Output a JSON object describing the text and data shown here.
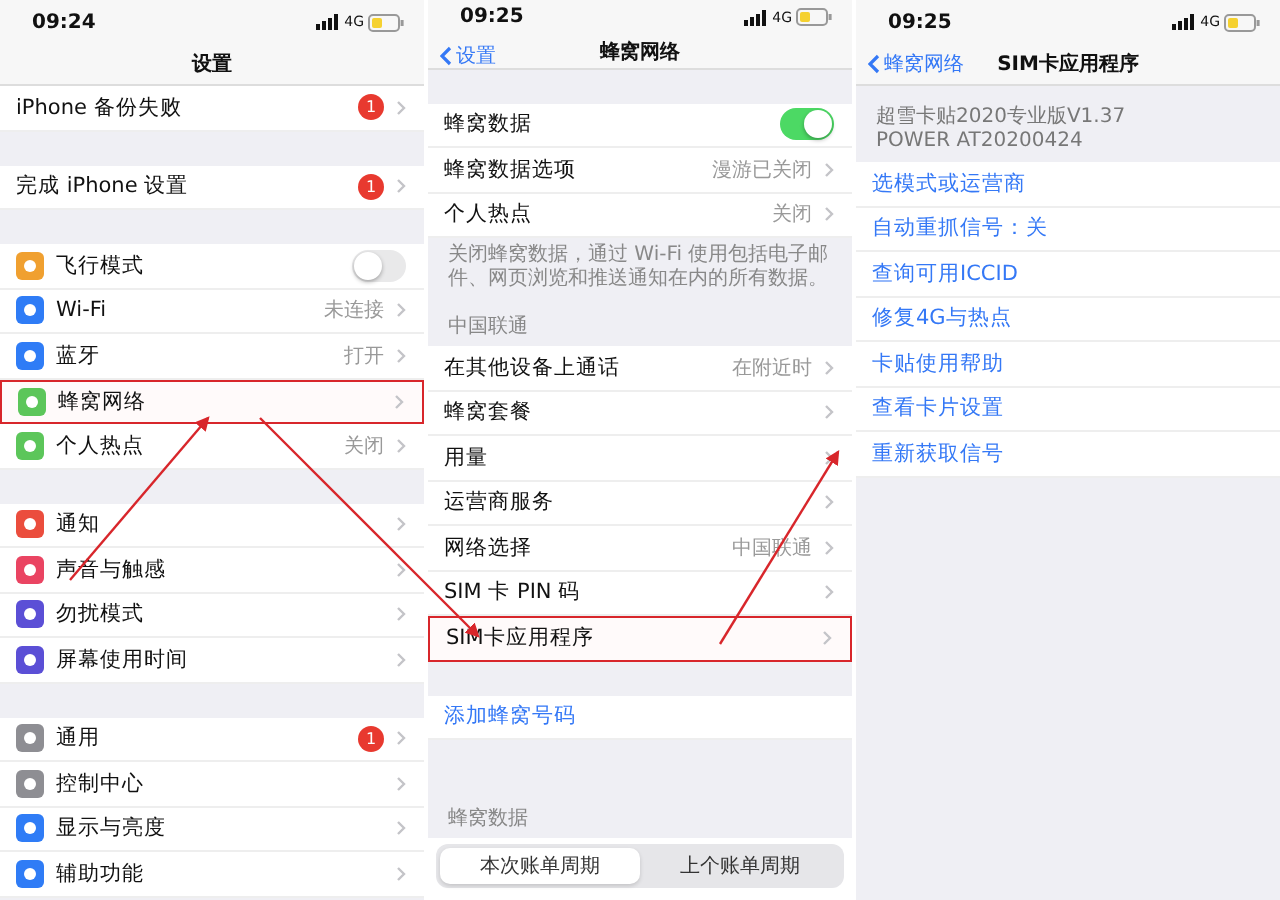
{
  "panels": [
    {
      "time": "09:24",
      "network": "4G",
      "title": "设置",
      "scrolled": true,
      "sections": [
        {
          "rows": [
            {
              "label": "iPhone 备份失败",
              "kind": "nav",
              "badge": "1",
              "highlighted": false
            }
          ]
        },
        {
          "rows": [
            {
              "label": "完成 iPhone 设置",
              "kind": "nav",
              "badge": "1",
              "highlighted": false
            }
          ]
        },
        {
          "rows": [
            {
              "label": "飞行模式",
              "kind": "toggle",
              "on": false,
              "color": "#f0a030",
              "highlighted": false
            },
            {
              "label": "Wi-Fi",
              "kind": "nav",
              "value": "未连接",
              "color": "#2f7cf6",
              "highlighted": false
            },
            {
              "label": "蓝牙",
              "kind": "nav",
              "value": "打开",
              "color": "#2f7cf6",
              "highlighted": false
            },
            {
              "label": "蜂窝网络",
              "kind": "nav",
              "color": "#5cc65a",
              "highlighted": true
            },
            {
              "label": "个人热点",
              "kind": "nav",
              "value": "关闭",
              "color": "#5cc65a",
              "highlighted": false
            }
          ]
        },
        {
          "rows": [
            {
              "label": "通知",
              "kind": "nav",
              "color": "#eb4d3d",
              "highlighted": false
            },
            {
              "label": "声音与触感",
              "kind": "nav",
              "color": "#ea4462",
              "highlighted": false
            },
            {
              "label": "勿扰模式",
              "kind": "nav",
              "color": "#5b4fd6",
              "highlighted": false
            },
            {
              "label": "屏幕使用时间",
              "kind": "nav",
              "color": "#5b4fd6",
              "highlighted": false
            }
          ]
        },
        {
          "rows": [
            {
              "label": "通用",
              "kind": "nav",
              "badge": "1",
              "color": "#8e8e93",
              "highlighted": false
            },
            {
              "label": "控制中心",
              "kind": "nav",
              "color": "#8e8e93",
              "highlighted": false
            },
            {
              "label": "显示与亮度",
              "kind": "nav",
              "color": "#2f7cf6",
              "highlighted": false
            },
            {
              "label": "辅助功能",
              "kind": "nav",
              "color": "#2f7cf6",
              "highlighted": false
            }
          ]
        }
      ]
    },
    {
      "time": "09:25",
      "network": "4G",
      "back": "设置",
      "title": "蜂窝网络",
      "scrolled": false,
      "sections": [
        {
          "rows": [
            {
              "label": "蜂窝数据",
              "kind": "toggle",
              "on": true,
              "highlighted": false
            },
            {
              "label": "蜂窝数据选项",
              "kind": "nav",
              "value": "漫游已关闭",
              "highlighted": false
            },
            {
              "label": "个人热点",
              "kind": "nav",
              "value": "关闭",
              "highlighted": false
            }
          ],
          "footer": "关闭蜂窝数据，通过 Wi-Fi 使用包括电子邮件、网页浏览和推送通知在内的所有数据。"
        },
        {
          "header": "中国联通",
          "rows": [
            {
              "label": "在其他设备上通话",
              "kind": "nav",
              "value": "在附近时",
              "highlighted": false
            },
            {
              "label": "蜂窝套餐",
              "kind": "nav",
              "highlighted": false
            },
            {
              "label": "用量",
              "kind": "nav",
              "highlighted": false
            },
            {
              "label": "运营商服务",
              "kind": "nav",
              "highlighted": false
            },
            {
              "label": "网络选择",
              "kind": "nav",
              "value": "中国联通",
              "highlighted": false
            },
            {
              "label": "SIM 卡 PIN 码",
              "kind": "nav",
              "highlighted": false
            },
            {
              "label": "SIM卡应用程序",
              "kind": "nav",
              "highlighted": true
            }
          ]
        },
        {
          "rows": [
            {
              "label": "添加蜂窝号码",
              "kind": "link",
              "highlighted": false
            }
          ]
        },
        {
          "header": "蜂窝数据",
          "segments": [
            {
              "label": "本次账单周期",
              "selected": true
            },
            {
              "label": "上个账单周期",
              "selected": false
            }
          ]
        }
      ]
    },
    {
      "time": "09:25",
      "network": "4G",
      "back": "蜂窝网络",
      "title": "SIM卡应用程序",
      "scrolled": false,
      "sections": [
        {
          "header_lines": [
            "超雪卡贴2020专业版V1.37",
            "POWER AT20200424"
          ],
          "rows": [
            {
              "label": "选模式或运营商",
              "kind": "link"
            },
            {
              "label": "自动重抓信号：关",
              "kind": "link"
            },
            {
              "label": "查询可用ICCID",
              "kind": "link"
            },
            {
              "label": "修复4G与热点",
              "kind": "link"
            },
            {
              "label": "卡贴使用帮助",
              "kind": "link"
            },
            {
              "label": "查看卡片设置",
              "kind": "link"
            },
            {
              "label": "重新获取信号",
              "kind": "link"
            }
          ]
        }
      ]
    }
  ]
}
